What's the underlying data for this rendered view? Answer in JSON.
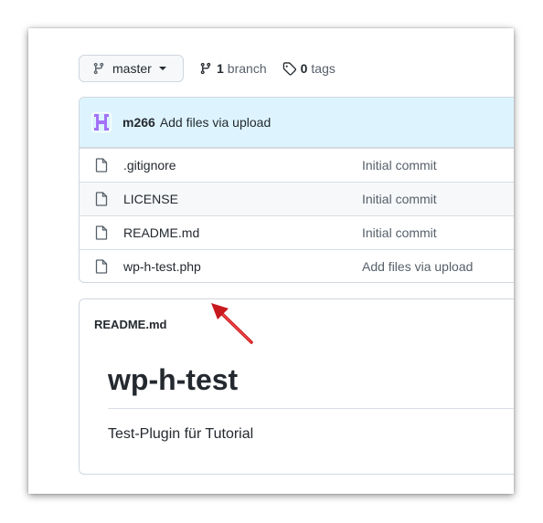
{
  "toolbar": {
    "branch_name": "master",
    "branches_count": "1",
    "branches_label": "branch",
    "tags_count": "0",
    "tags_label": "tags"
  },
  "commit": {
    "author": "m266",
    "message": "Add files via upload"
  },
  "files": [
    {
      "name": ".gitignore",
      "message": "Initial commit"
    },
    {
      "name": "LICENSE",
      "message": "Initial commit"
    },
    {
      "name": "README.md",
      "message": "Initial commit"
    },
    {
      "name": "wp-h-test.php",
      "message": "Add files via upload"
    }
  ],
  "readme": {
    "file_label": "README.md",
    "heading": "wp-h-test",
    "text": "Test-Plugin für Tutorial"
  },
  "colors": {
    "commit_bar_bg": "#ddf4ff",
    "avatar_purple": "#a371f7",
    "arrow_red": "#c8191e"
  },
  "icons": [
    "git-branch-icon",
    "tag-icon",
    "file-icon",
    "avatar-icon",
    "annotation-arrow-icon"
  ]
}
